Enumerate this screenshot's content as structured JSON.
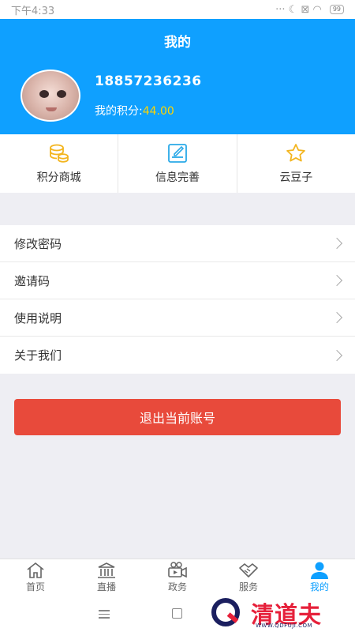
{
  "status_bar": {
    "time": "下午4:33",
    "icons": "··· ☾ ⊠ ◠",
    "battery": "99"
  },
  "header": {
    "title": "我的",
    "phone": "18857236236",
    "points_label": "我的积分:",
    "points_value": "44.00"
  },
  "quick_actions": [
    {
      "label": "积分商城",
      "icon": "coins-icon"
    },
    {
      "label": "信息完善",
      "icon": "edit-icon"
    },
    {
      "label": "云豆子",
      "icon": "star-icon"
    }
  ],
  "menu": [
    {
      "label": "修改密码"
    },
    {
      "label": "邀请码"
    },
    {
      "label": "使用说明"
    },
    {
      "label": "关于我们"
    }
  ],
  "logout_label": "退出当前账号",
  "tabbar": [
    {
      "label": "首页",
      "icon": "home-icon"
    },
    {
      "label": "直播",
      "icon": "building-icon"
    },
    {
      "label": "政务",
      "icon": "video-camera-icon"
    },
    {
      "label": "服务",
      "icon": "handshake-icon"
    },
    {
      "label": "我的",
      "icon": "person-icon",
      "active": true
    }
  ],
  "watermark": {
    "text": "清道夫",
    "url": "WWW.QDFUJI.COM"
  },
  "colors": {
    "primary": "#0fa0ff",
    "danger": "#e84a3b",
    "points": "#ffd400",
    "coin": "#f3b51f"
  }
}
